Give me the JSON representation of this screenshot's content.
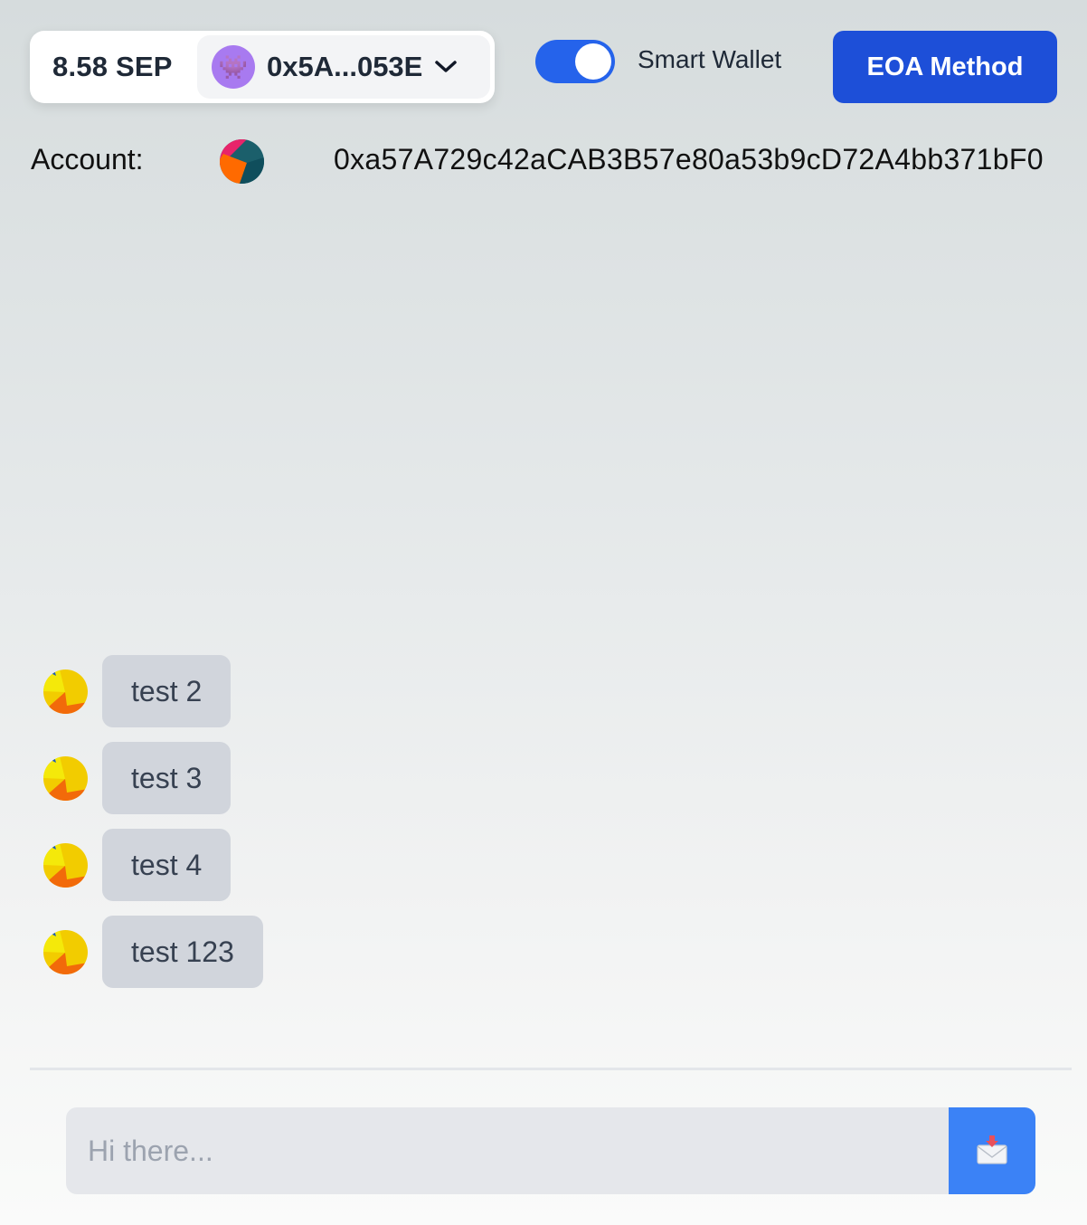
{
  "wallet": {
    "balance": "8.58 SEP",
    "avatar_icon": "alien-monster-icon",
    "avatar_glyph": "👾",
    "short_address": "0x5A...053E",
    "dropdown_icon": "chevron-down-icon"
  },
  "smart_wallet_toggle": {
    "label": "Smart Wallet",
    "on": true
  },
  "eoa_button": {
    "label": "EOA Method"
  },
  "account": {
    "label": "Account:",
    "address": "0xa57A729c42aCAB3B57e80a53b9cD72A4bb371bF0"
  },
  "messages": [
    {
      "text": "test 2"
    },
    {
      "text": "test 3"
    },
    {
      "text": "test 4"
    },
    {
      "text": "test 123"
    }
  ],
  "composer": {
    "placeholder": "Hi there...",
    "send_icon": "incoming-envelope-icon"
  },
  "colors": {
    "accent": "#1d4fd8",
    "toggle_on": "#2563eb",
    "send_button": "#3b82f6",
    "bubble": "#d1d5dc",
    "wallet_avatar": "#a87af0"
  }
}
